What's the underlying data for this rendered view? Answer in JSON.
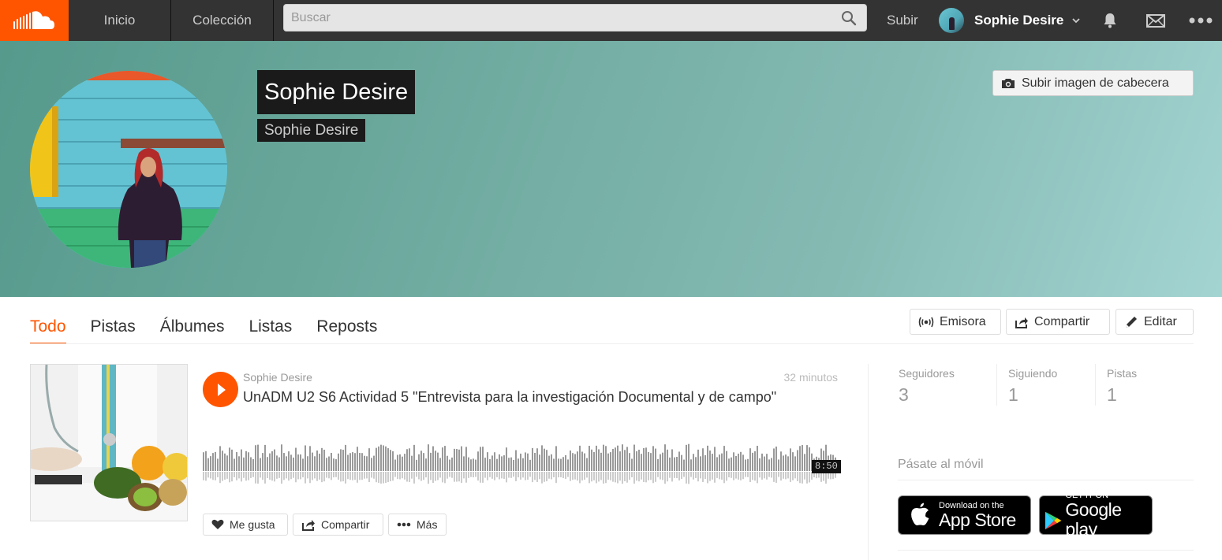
{
  "nav": {
    "home_label": "Inicio",
    "collection_label": "Colección",
    "search_placeholder": "Buscar",
    "upload_label": "Subir",
    "user_name": "Sophie Desire"
  },
  "profile": {
    "display_name": "Sophie Desire",
    "username": "Sophie Desire",
    "upload_header_label": "Subir imagen de cabecera"
  },
  "tabs": [
    {
      "label": "Todo",
      "active": true
    },
    {
      "label": "Pistas",
      "active": false
    },
    {
      "label": "Álbumes",
      "active": false
    },
    {
      "label": "Listas",
      "active": false
    },
    {
      "label": "Reposts",
      "active": false
    }
  ],
  "profile_actions": {
    "station_label": "Emisora",
    "share_label": "Compartir",
    "edit_label": "Editar"
  },
  "track": {
    "user": "Sophie Desire",
    "posted": "32 minutos",
    "title": "UnADM U2 S6 Actividad 5 \"Entrevista para la investigación Documental y de campo\"",
    "duration": "8:50",
    "like_label": "Me gusta",
    "share_label": "Compartir",
    "more_label": "Más"
  },
  "stats": [
    {
      "label": "Seguidores",
      "value": "3"
    },
    {
      "label": "Siguiendo",
      "value": "1"
    },
    {
      "label": "Pistas",
      "value": "1"
    }
  ],
  "mobile": {
    "title": "Pásate al móvil",
    "app_store_small": "Download on the",
    "app_store_big": "App Store",
    "google_small": "GET IT ON",
    "google_big": "Google play"
  },
  "colors": {
    "accent": "#ff5500",
    "topbar": "#333333"
  }
}
